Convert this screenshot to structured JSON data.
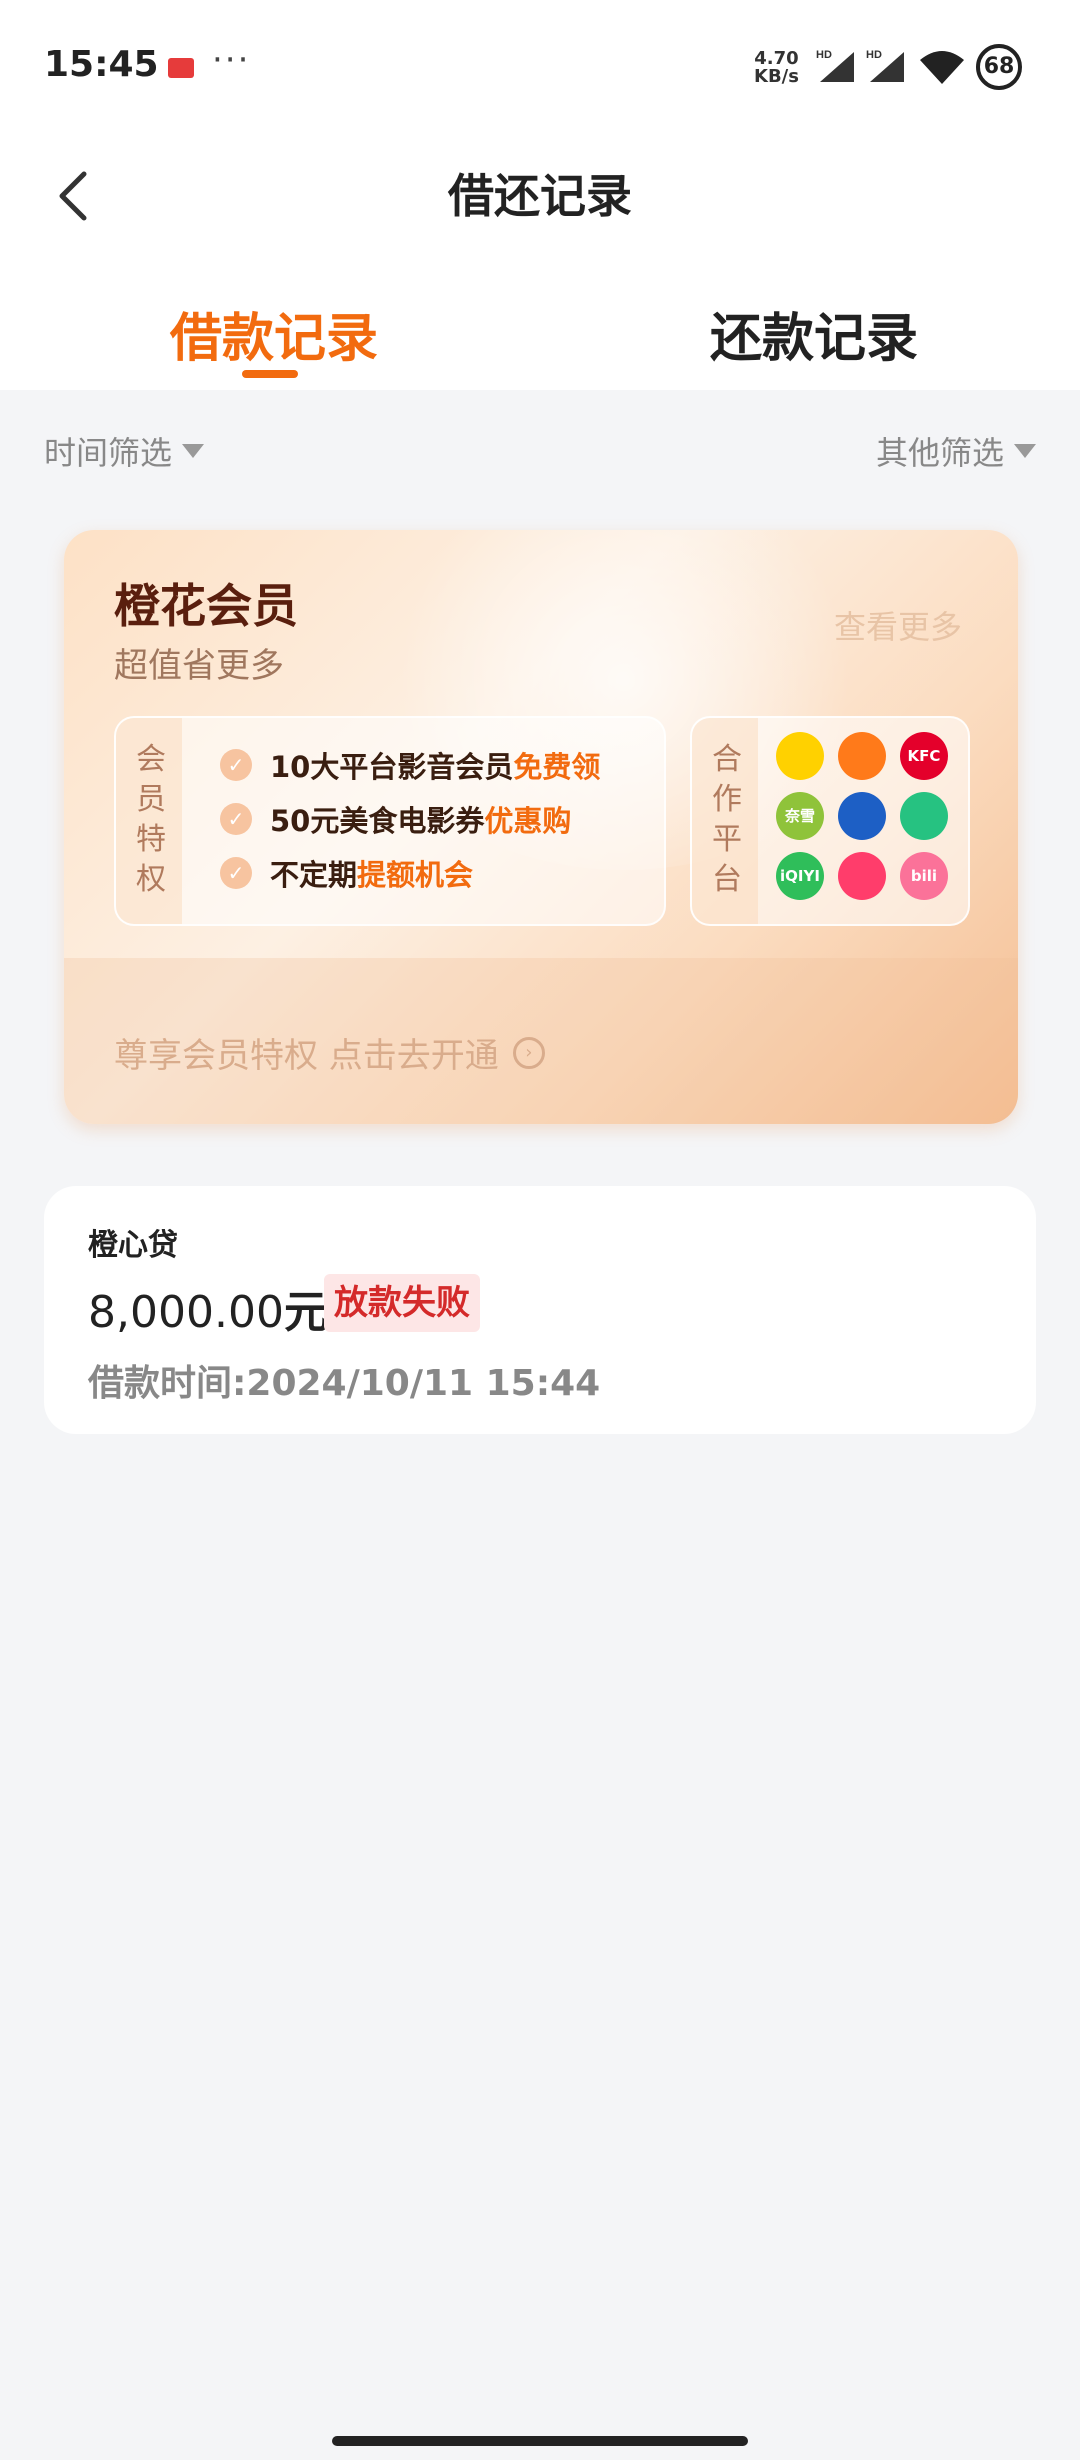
{
  "status_bar": {
    "time": "15:45",
    "more": "···",
    "speed_value": "4.70",
    "speed_unit": "KB/s",
    "signal_tag": "HD",
    "battery": "68"
  },
  "header": {
    "title": "借还记录"
  },
  "tabs": [
    {
      "label": "借款记录",
      "active": true
    },
    {
      "label": "还款记录",
      "active": false
    }
  ],
  "filters": {
    "time": "时间筛选",
    "other": "其他筛选"
  },
  "member_card": {
    "title": "橙花会员",
    "subtitle": "超值省更多",
    "view_more": "查看更多",
    "benefits_label": [
      "会",
      "员",
      "特",
      "权"
    ],
    "benefits": [
      {
        "text": "10大平台影音会员",
        "highlight": "免费领"
      },
      {
        "text": "50元美食电影券",
        "highlight": "优惠购"
      },
      {
        "text": "不定期",
        "highlight": "提额机会"
      }
    ],
    "partners_label": [
      "合",
      "作",
      "平",
      "台"
    ],
    "partners": [
      {
        "name": "美团",
        "text": "",
        "color": "#ffd100"
      },
      {
        "name": "滴滴",
        "text": "",
        "color": "#ff7a1a"
      },
      {
        "name": "KFC",
        "text": "KFC",
        "color": "#e4002b"
      },
      {
        "name": "奈雪的茶",
        "text": "奈雪",
        "color": "#8fc33a"
      },
      {
        "name": "携程",
        "text": "",
        "color": "#1d5fc5"
      },
      {
        "name": "腾讯视频",
        "text": "",
        "color": "#26c281"
      },
      {
        "name": "iQIYI",
        "text": "iQIYI",
        "color": "#2fbe5a"
      },
      {
        "name": "优酷",
        "text": "",
        "color": "#ff3d6b"
      },
      {
        "name": "bilibili",
        "text": "bili",
        "color": "#fb7299"
      }
    ],
    "cta": "尊享会员特权  点击去开通"
  },
  "loans": [
    {
      "product": "橙心贷",
      "amount": "8,000.00",
      "unit": "元",
      "status": "放款失败",
      "time": "借款时间:2024/10/11 15:44"
    }
  ],
  "colors": {
    "accent": "#f26b0f",
    "status_fail": "#d42a2a",
    "background": "#f4f5f7"
  }
}
